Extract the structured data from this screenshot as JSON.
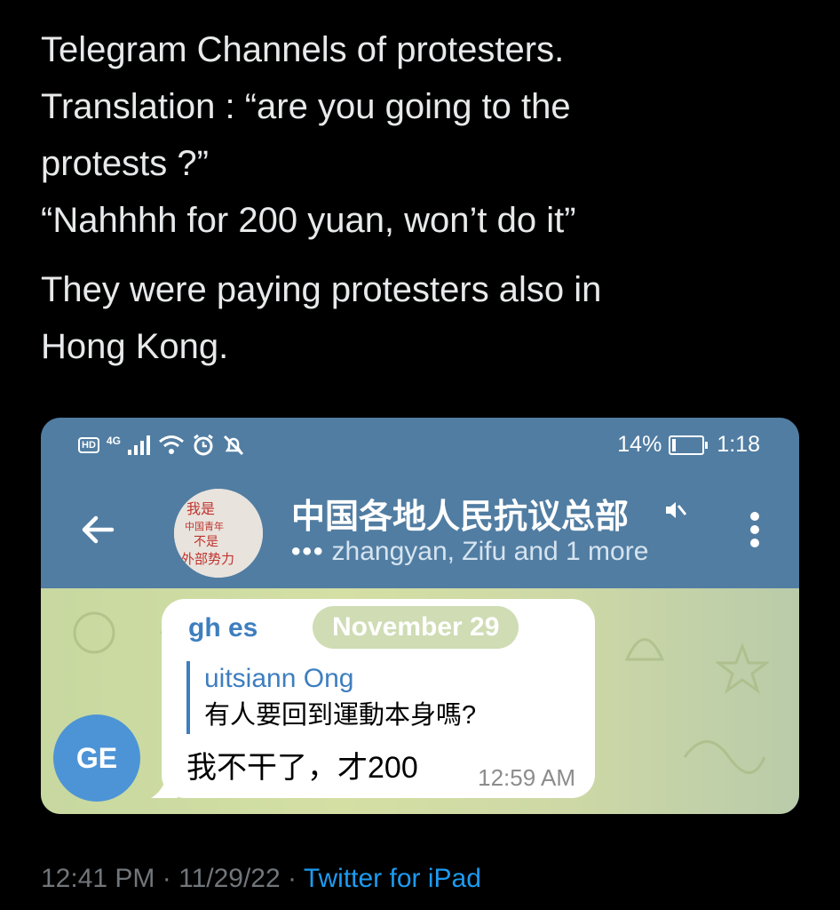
{
  "tweet": {
    "lines_p1": [
      "Telegram Channels of protesters.",
      "Translation : “are you going to the",
      "protests ?”",
      "“Nahhhh for 200 yuan, won’t do it”"
    ],
    "lines_p2": [
      "They were paying protesters also in",
      "Hong Kong."
    ],
    "time": "12:41 PM",
    "date": "11/29/22",
    "separator": "·",
    "source": "Twitter for iPad"
  },
  "phone": {
    "status_bar": {
      "hd": "HD",
      "network": "4G",
      "battery_percent": "14%",
      "battery_level": 0.14,
      "clock": "1:18",
      "icons": [
        "signal-icon",
        "wifi-icon",
        "alarm-icon",
        "notifications-off-icon",
        "battery-charging-icon"
      ]
    },
    "chat": {
      "title": "中国各地人民抗议总部",
      "typing_dots": "•••",
      "subtitle": "zhangyan, Zifu and 1 more",
      "avatar_text": [
        "我是",
        "中国青年",
        "不是",
        "外部势力"
      ]
    },
    "message": {
      "sender_avatar_initials": "GE",
      "sender_name": "gh es",
      "date_pill": "November 29",
      "reply_name": "uitsiann Ong",
      "reply_text": "有人要回到運動本身嗎?",
      "text": "我不干了，才200",
      "time": "12:59 AM"
    },
    "colors": {
      "header": "#517da2",
      "link_blue": "#3e7ebf",
      "avatar_blue": "#4d94d7"
    }
  }
}
